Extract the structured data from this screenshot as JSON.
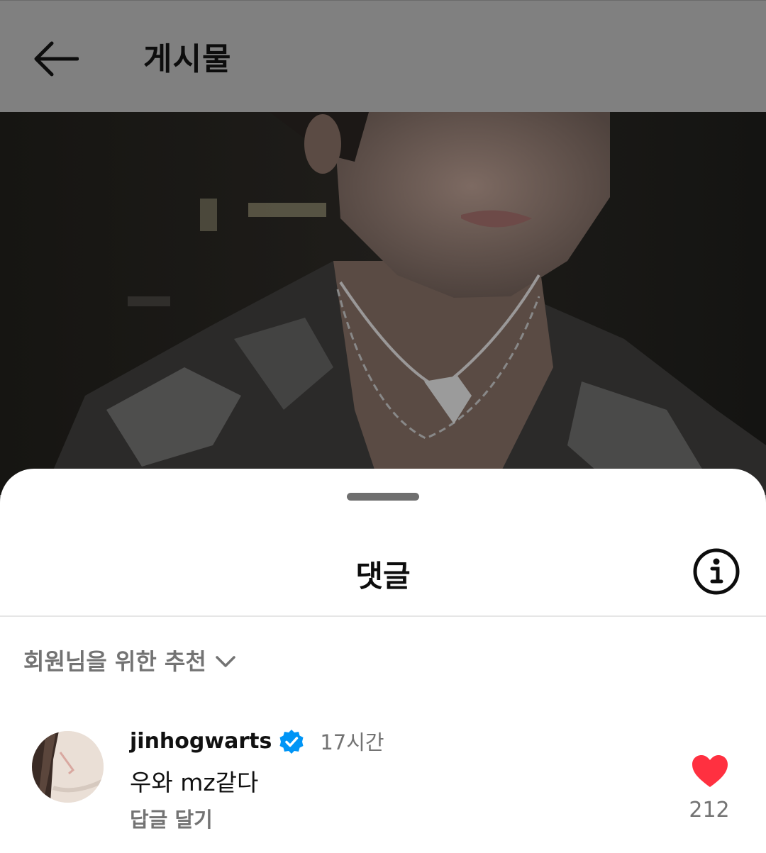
{
  "app_bar": {
    "back_icon": "arrow-left-icon",
    "title": "게시물"
  },
  "post_image": {
    "description_icon": "photo"
  },
  "comments_sheet": {
    "title": "댓글",
    "info_icon": "info-circle-icon",
    "sort_label": "회원님을 위한 추천",
    "sort_icon": "chevron-down-icon",
    "comments": [
      {
        "username": "jinhogwarts",
        "verified": true,
        "time": "17시간",
        "text": "우와 mz같다",
        "reply_label": "답글 달기",
        "liked": true,
        "like_count": "212"
      }
    ]
  },
  "colors": {
    "dim_overlay": "#808080",
    "like_red": "#ff3040",
    "verified_blue": "#0095f6",
    "secondary_text": "#737373"
  }
}
